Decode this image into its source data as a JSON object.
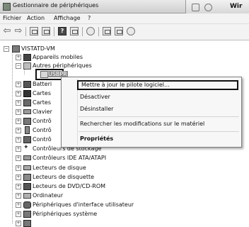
{
  "window": {
    "title": "Gestionnaire de périphériques",
    "right_pane_text": "Wir"
  },
  "menu": {
    "items": [
      "Fichier",
      "Action",
      "Affichage",
      "?"
    ]
  },
  "toolbar": {
    "icons": [
      "back-arrow-icon",
      "forward-arrow-icon",
      "view-icon",
      "properties-icon",
      "help-icon",
      "view2-icon",
      "scan-icon",
      "update-driver-icon",
      "uninstall-icon",
      "disable-icon"
    ]
  },
  "tree": {
    "root": "VISTATD-VM",
    "nodes": [
      "Appareils mobiles",
      "Autres périphériques",
      "USBPR",
      "Batteri",
      "Cartes",
      "Cartes",
      "Clavier",
      "Contrô",
      "Contrô",
      "Contrô",
      "Contrôleurs de stockage",
      "Contrôleurs IDE ATA/ATAPI",
      "Lecteurs de disque",
      "Lecteurs de disquette",
      "Lecteurs de DVD/CD-ROM",
      "Ordinateur",
      "Périphériques d'interface utilisateur",
      "Périphériques système"
    ]
  },
  "context_menu": {
    "items": [
      "Mettre à jour le pilote logiciel...",
      "Désactiver",
      "Désinstaller",
      "Rechercher les modifications sur le matériel",
      "Propriétés"
    ]
  }
}
